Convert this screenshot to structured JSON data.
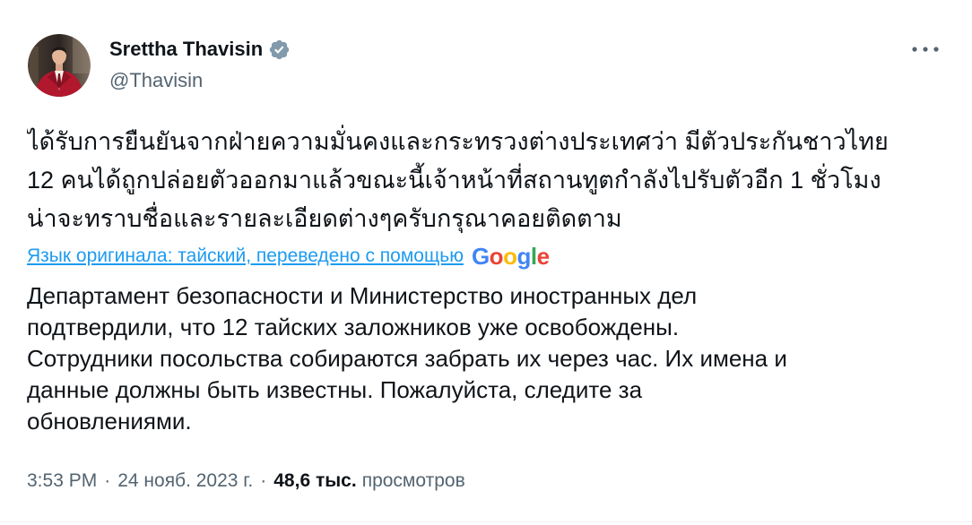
{
  "author": {
    "name": "Srettha Thavisin",
    "handle": "@Thavisin",
    "verified_icon": "verified-badge-icon",
    "verified_badge_color": "#829AAB"
  },
  "header": {
    "more_icon": "more-horizontal-icon"
  },
  "tweet": {
    "original_lines": [
      "ได้รับการยืนยันจากฝ่ายความมั่นคงและกระทรวงต่างประเทศว่า มีตัวประกันชาวไทย",
      "12 คนได้ถูกปล่อยตัวออกมาแล้วขณะนี้เจ้าหน้าที่สถานทูตกำลังไปรับตัวอีก 1 ชั่วโมง",
      "น่าจะทราบชื่อและรายละเอียดต่างๆครับกรุณาคอยติดตาม"
    ],
    "translation_link": "Язык оригинала: тайский, переведено с помощью",
    "logo_letters": [
      {
        "ch": "G",
        "color": "#4285F4"
      },
      {
        "ch": "o",
        "color": "#EA4335"
      },
      {
        "ch": "o",
        "color": "#FBBC05"
      },
      {
        "ch": "g",
        "color": "#4285F4"
      },
      {
        "ch": "l",
        "color": "#34A853"
      },
      {
        "ch": "e",
        "color": "#EA4335"
      }
    ],
    "translated_lines": [
      "Департамент безопасности и Министерство иностранных дел",
      "подтвердили, что 12 тайских заложников уже освобождены.",
      "Сотрудники посольства собираются забрать их через час. Их имена и",
      "данные должны быть известны. Пожалуйста, следите за",
      "обновлениями."
    ]
  },
  "meta": {
    "time": "3:53 PM",
    "separator": "·",
    "date": "24 нояб. 2023 г.",
    "views_count": "48,6 тыс.",
    "views_label": "просмотров"
  },
  "colors": {
    "text": "#0F1419",
    "secondary": "#536471",
    "link": "#1D9BF0",
    "divider": "#EFF3F4",
    "background": "#FFFFFF"
  }
}
